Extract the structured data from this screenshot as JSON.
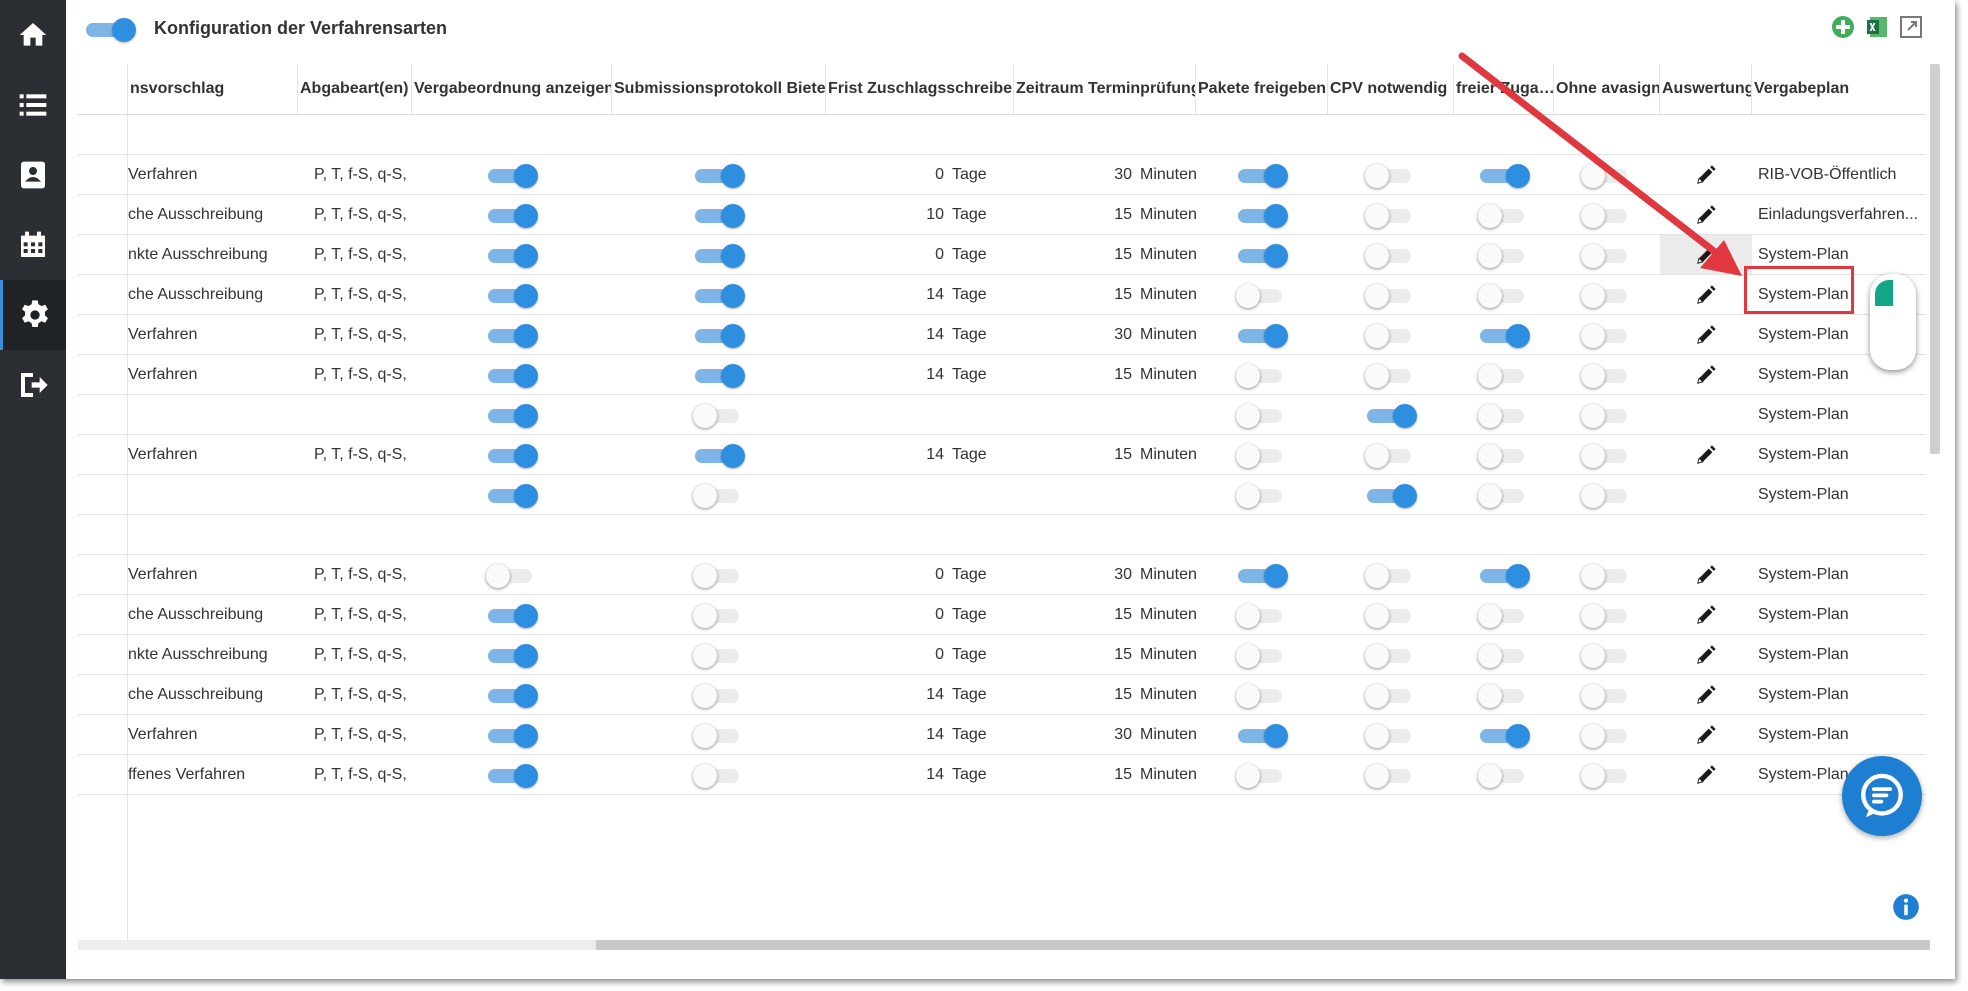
{
  "header": {
    "title": "Konfiguration der Verfahrensarten",
    "main_toggle_on": true
  },
  "sidebar": {
    "items": [
      "home-icon",
      "list-icon",
      "contacts-icon",
      "calendar-icon",
      "gear-icon",
      "logout-icon"
    ],
    "active": "gear-icon"
  },
  "columns": [
    "…nsvorschlag",
    "Abgabeart(en)",
    "Vergabeordnung anzeigen",
    "Submissionsprotokoll Bieter",
    "Frist Zuschlagsschreiben",
    "Zeitraum Terminprüfung",
    "Pakete freigeben",
    "CPV notwendig",
    "freier Zuga…",
    "Ohne avasign",
    "Auswertung",
    "Vergabeplan"
  ],
  "rows": [
    {
      "name": "",
      "abgabe": "",
      "vergabeordnung": null,
      "submission": null,
      "frist": "",
      "frist_unit": "",
      "zeitraum": "",
      "zeitraum_unit": "",
      "pakete": null,
      "cpv": null,
      "freier": null,
      "ohne": null,
      "edit": false,
      "plan": ""
    },
    {
      "name": "Verfahren",
      "abgabe": "P, T, f-S, q-S, ...",
      "vergabeordnung": true,
      "submission": true,
      "frist": "0",
      "frist_unit": "Tage",
      "zeitraum": "30",
      "zeitraum_unit": "Minuten",
      "pakete": true,
      "cpv": false,
      "freier": true,
      "ohne": false,
      "edit": true,
      "plan": "RIB-VOB-Öffentlich"
    },
    {
      "name": "che Ausschreibung",
      "abgabe": "P, T, f-S, q-S, ...",
      "vergabeordnung": true,
      "submission": true,
      "frist": "10",
      "frist_unit": "Tage",
      "zeitraum": "15",
      "zeitraum_unit": "Minuten",
      "pakete": true,
      "cpv": false,
      "freier": false,
      "ohne": false,
      "edit": true,
      "plan": "Einladungsverfahren..."
    },
    {
      "name": "nkte Ausschreibung",
      "abgabe": "P, T, f-S, q-S, ...",
      "vergabeordnung": true,
      "submission": true,
      "frist": "0",
      "frist_unit": "Tage",
      "zeitraum": "15",
      "zeitraum_unit": "Minuten",
      "pakete": true,
      "cpv": false,
      "freier": false,
      "ohne": false,
      "edit": true,
      "plan": "System-Plan",
      "highlight": true
    },
    {
      "name": "che Ausschreibung",
      "abgabe": "P, T, f-S, q-S, ...",
      "vergabeordnung": true,
      "submission": true,
      "frist": "14",
      "frist_unit": "Tage",
      "zeitraum": "15",
      "zeitraum_unit": "Minuten",
      "pakete": false,
      "cpv": false,
      "freier": false,
      "ohne": false,
      "edit": true,
      "plan": "System-Plan"
    },
    {
      "name": "Verfahren",
      "abgabe": "P, T, f-S, q-S, ...",
      "vergabeordnung": true,
      "submission": true,
      "frist": "14",
      "frist_unit": "Tage",
      "zeitraum": "30",
      "zeitraum_unit": "Minuten",
      "pakete": true,
      "cpv": false,
      "freier": true,
      "ohne": false,
      "edit": true,
      "plan": "System-Plan"
    },
    {
      "name": "Verfahren",
      "abgabe": "P, T, f-S, q-S, ...",
      "vergabeordnung": true,
      "submission": true,
      "frist": "14",
      "frist_unit": "Tage",
      "zeitraum": "15",
      "zeitraum_unit": "Minuten",
      "pakete": false,
      "cpv": false,
      "freier": false,
      "ohne": false,
      "edit": true,
      "plan": "System-Plan"
    },
    {
      "name": "",
      "abgabe": "",
      "vergabeordnung": true,
      "submission": false,
      "frist": "",
      "frist_unit": "",
      "zeitraum": "",
      "zeitraum_unit": "",
      "pakete": false,
      "cpv": true,
      "freier": false,
      "ohne": false,
      "edit": false,
      "plan": "System-Plan"
    },
    {
      "name": "Verfahren",
      "abgabe": "P, T, f-S, q-S, ...",
      "vergabeordnung": true,
      "submission": true,
      "frist": "14",
      "frist_unit": "Tage",
      "zeitraum": "15",
      "zeitraum_unit": "Minuten",
      "pakete": false,
      "cpv": false,
      "freier": false,
      "ohne": false,
      "edit": true,
      "plan": "System-Plan"
    },
    {
      "name": "",
      "abgabe": "",
      "vergabeordnung": true,
      "submission": false,
      "frist": "",
      "frist_unit": "",
      "zeitraum": "",
      "zeitraum_unit": "",
      "pakete": false,
      "cpv": true,
      "freier": false,
      "ohne": false,
      "edit": false,
      "plan": "System-Plan"
    },
    {
      "name": "",
      "abgabe": "",
      "vergabeordnung": null,
      "submission": null,
      "frist": "",
      "frist_unit": "",
      "zeitraum": "",
      "zeitraum_unit": "",
      "pakete": null,
      "cpv": null,
      "freier": null,
      "ohne": null,
      "edit": false,
      "plan": ""
    },
    {
      "name": "Verfahren",
      "abgabe": "P, T, f-S, q-S, ...",
      "vergabeordnung": false,
      "submission": false,
      "frist": "0",
      "frist_unit": "Tage",
      "zeitraum": "30",
      "zeitraum_unit": "Minuten",
      "pakete": true,
      "cpv": false,
      "freier": true,
      "ohne": false,
      "edit": true,
      "plan": "System-Plan"
    },
    {
      "name": "che Ausschreibung",
      "abgabe": "P, T, f-S, q-S, ...",
      "vergabeordnung": true,
      "submission": false,
      "frist": "0",
      "frist_unit": "Tage",
      "zeitraum": "15",
      "zeitraum_unit": "Minuten",
      "pakete": false,
      "cpv": false,
      "freier": false,
      "ohne": false,
      "edit": true,
      "plan": "System-Plan"
    },
    {
      "name": "nkte Ausschreibung",
      "abgabe": "P, T, f-S, q-S, ...",
      "vergabeordnung": true,
      "submission": false,
      "frist": "0",
      "frist_unit": "Tage",
      "zeitraum": "15",
      "zeitraum_unit": "Minuten",
      "pakete": false,
      "cpv": false,
      "freier": false,
      "ohne": false,
      "edit": true,
      "plan": "System-Plan"
    },
    {
      "name": "che Ausschreibung",
      "abgabe": "P, T, f-S, q-S, ...",
      "vergabeordnung": true,
      "submission": false,
      "frist": "14",
      "frist_unit": "Tage",
      "zeitraum": "15",
      "zeitraum_unit": "Minuten",
      "pakete": false,
      "cpv": false,
      "freier": false,
      "ohne": false,
      "edit": true,
      "plan": "System-Plan"
    },
    {
      "name": "Verfahren",
      "abgabe": "P, T, f-S, q-S, ...",
      "vergabeordnung": true,
      "submission": false,
      "frist": "14",
      "frist_unit": "Tage",
      "zeitraum": "30",
      "zeitraum_unit": "Minuten",
      "pakete": true,
      "cpv": false,
      "freier": true,
      "ohne": false,
      "edit": true,
      "plan": "System-Plan"
    },
    {
      "name": "ffenes Verfahren",
      "abgabe": "P, T, f-S, q-S, ...",
      "vergabeordnung": true,
      "submission": false,
      "frist": "14",
      "frist_unit": "Tage",
      "zeitraum": "15",
      "zeitraum_unit": "Minuten",
      "pakete": false,
      "cpv": false,
      "freier": false,
      "ohne": false,
      "edit": true,
      "plan": "System-Plan"
    }
  ],
  "colors": {
    "sidebar_bg": "#2b2f33",
    "toggle_on": "#2e8fe0",
    "toggle_track_on": "#7fb4e6",
    "callout": "#e0383e",
    "chat": "#1e7fd2"
  }
}
